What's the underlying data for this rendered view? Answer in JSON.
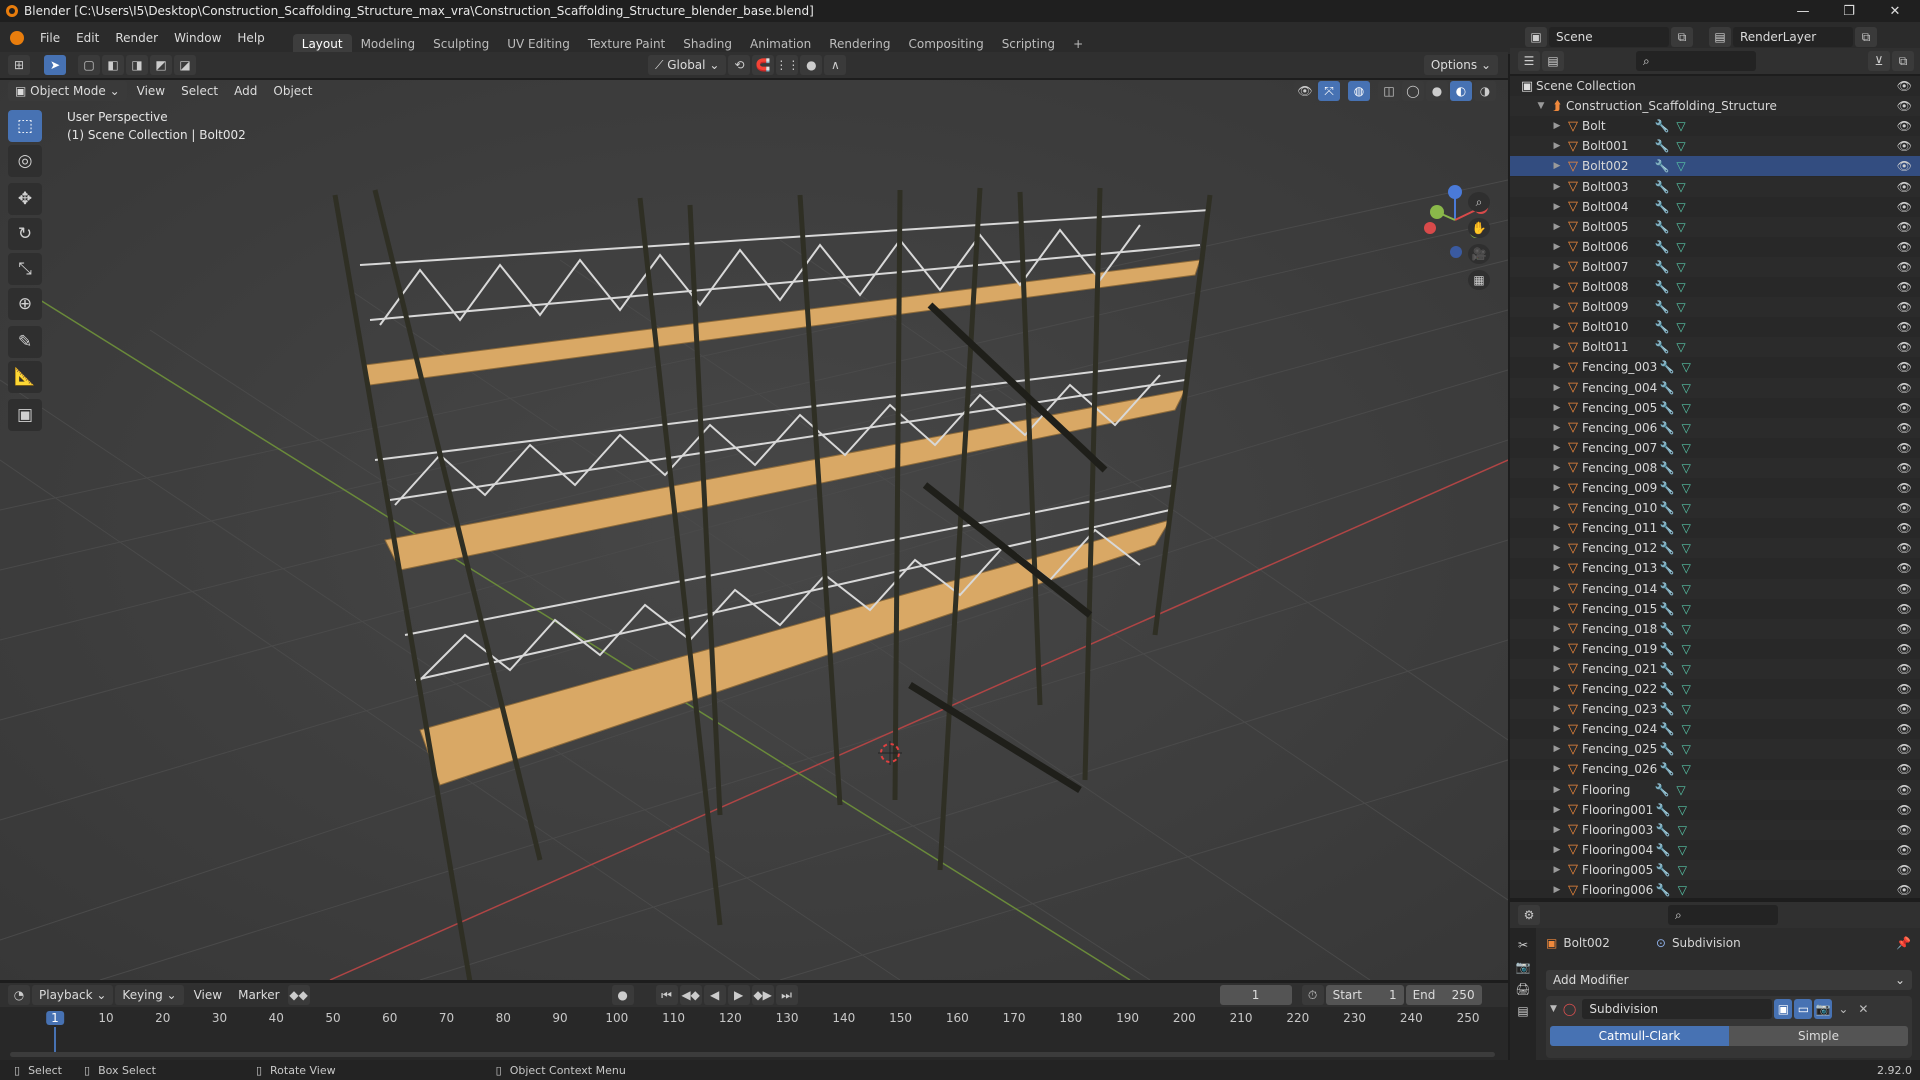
{
  "window": {
    "title": "Blender [C:\\Users\\I5\\Desktop\\Construction_Scaffolding_Structure_max_vra\\Construction_Scaffolding_Structure_blender_base.blend]",
    "controls": [
      "—",
      "❐",
      "✕"
    ]
  },
  "menus": [
    "File",
    "Edit",
    "Render",
    "Window",
    "Help"
  ],
  "workspaces": [
    "Layout",
    "Modeling",
    "Sculpting",
    "UV Editing",
    "Texture Paint",
    "Shading",
    "Animation",
    "Rendering",
    "Compositing",
    "Scripting"
  ],
  "active_workspace": "Layout",
  "scene": {
    "name": "Scene",
    "render_layer": "RenderLayer"
  },
  "tool_header": {
    "orientation": "Global",
    "options_label": "Options"
  },
  "viewport_header": {
    "mode": "Object Mode",
    "menus": [
      "View",
      "Select",
      "Add",
      "Object"
    ]
  },
  "viewport": {
    "perspective": "User Perspective",
    "collection_info": "(1) Scene Collection | Bolt002",
    "gizmo_axes": [
      "X",
      "Y",
      "Z"
    ]
  },
  "tools": [
    {
      "name": "select-box-tool",
      "glyph": "⬚",
      "active": true
    },
    {
      "name": "cursor-tool",
      "glyph": "◎"
    },
    {
      "name": "move-tool",
      "glyph": "✥"
    },
    {
      "name": "rotate-tool",
      "glyph": "↻"
    },
    {
      "name": "scale-tool",
      "glyph": "⤡"
    },
    {
      "name": "transform-tool",
      "glyph": "⊕"
    },
    {
      "name": "annotate-tool",
      "glyph": "✎"
    },
    {
      "name": "measure-tool",
      "glyph": "📐"
    },
    {
      "name": "add-cube-tool",
      "glyph": "▣"
    }
  ],
  "outliner": {
    "root": "Scene Collection",
    "collection": "Construction_Scaffolding_Structure",
    "objects": [
      "Bolt",
      "Bolt001",
      "Bolt002",
      "Bolt003",
      "Bolt004",
      "Bolt005",
      "Bolt006",
      "Bolt007",
      "Bolt008",
      "Bolt009",
      "Bolt010",
      "Bolt011",
      "Fencing_003",
      "Fencing_004",
      "Fencing_005",
      "Fencing_006",
      "Fencing_007",
      "Fencing_008",
      "Fencing_009",
      "Fencing_010",
      "Fencing_011",
      "Fencing_012",
      "Fencing_013",
      "Fencing_014",
      "Fencing_015",
      "Fencing_018",
      "Fencing_019",
      "Fencing_021",
      "Fencing_022",
      "Fencing_023",
      "Fencing_024",
      "Fencing_025",
      "Fencing_026",
      "Flooring",
      "Flooring001",
      "Flooring003",
      "Flooring004",
      "Flooring005",
      "Flooring006"
    ],
    "selected": "Bolt002"
  },
  "properties": {
    "object": "Bolt002",
    "modifier_context": "Subdivision",
    "add_modifier": "Add Modifier",
    "modifier_name": "Subdivision",
    "algorithms": [
      "Catmull-Clark",
      "Simple"
    ],
    "active_algorithm": "Catmull-Clark"
  },
  "timeline": {
    "menus": [
      "Playback",
      "Keying",
      "View",
      "Marker"
    ],
    "current_frame": "1",
    "start_label": "Start",
    "start": "1",
    "end_label": "End",
    "end": "250",
    "ticks": [
      "1",
      "10",
      "20",
      "30",
      "40",
      "50",
      "60",
      "70",
      "80",
      "90",
      "100",
      "110",
      "120",
      "130",
      "140",
      "150",
      "160",
      "170",
      "180",
      "190",
      "200",
      "210",
      "220",
      "230",
      "240",
      "250"
    ]
  },
  "statusbar": {
    "select": "Select",
    "box_select": "Box Select",
    "rotate": "Rotate View",
    "context": "Object Context Menu",
    "version": "2.92.0"
  },
  "colors": {
    "accent": "#4772b3",
    "object": "#f0893c",
    "mesh": "#56c4a6",
    "plank": "#d9a865"
  }
}
